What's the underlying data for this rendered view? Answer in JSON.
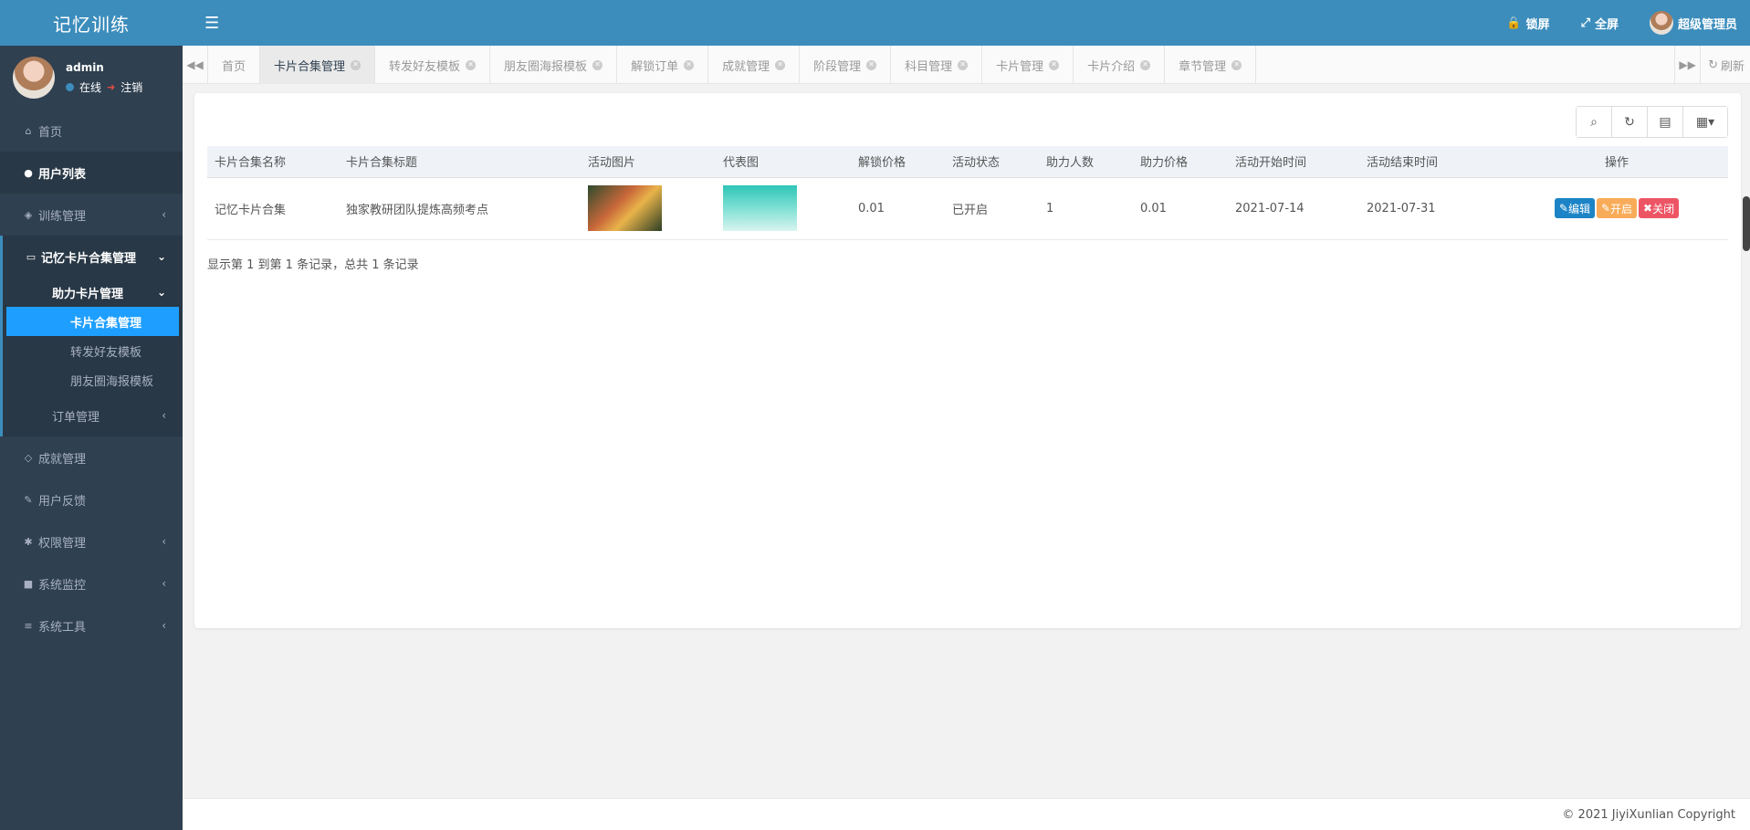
{
  "brand": "记忆训练",
  "user": {
    "name": "admin",
    "status": "在线",
    "logout": "注销"
  },
  "sidebar": {
    "items": [
      {
        "label": "首页",
        "icon": "home-icon"
      },
      {
        "label": "用户列表",
        "icon": "user-circle-icon"
      },
      {
        "label": "训练管理",
        "icon": "cube-icon"
      },
      {
        "label": "记忆卡片合集管理",
        "icon": "card-icon"
      },
      {
        "label": "成就管理",
        "icon": "diamond-icon"
      },
      {
        "label": "用户反馈",
        "icon": "edit-icon"
      },
      {
        "label": "权限管理",
        "icon": "gear-icon"
      },
      {
        "label": "系统监控",
        "icon": "video-icon"
      },
      {
        "label": "系统工具",
        "icon": "bars-icon"
      }
    ],
    "submenu": {
      "head": "助力卡片管理",
      "items": [
        "卡片合集管理",
        "转发好友模板",
        "朋友圈海报模板"
      ],
      "order": "订单管理"
    }
  },
  "topbar": {
    "lock": "锁屏",
    "fullscreen": "全屏",
    "admin": "超级管理员"
  },
  "tabs": [
    "首页",
    "卡片合集管理",
    "转发好友模板",
    "朋友圈海报模板",
    "解锁订单",
    "成就管理",
    "阶段管理",
    "科目管理",
    "卡片管理",
    "卡片介绍",
    "章节管理"
  ],
  "refresh": "刷新",
  "table": {
    "headers": [
      "卡片合集名称",
      "卡片合集标题",
      "活动图片",
      "代表图",
      "解锁价格",
      "活动状态",
      "助力人数",
      "助力价格",
      "活动开始时间",
      "活动结束时间",
      "操作"
    ],
    "rows": [
      {
        "name": "记忆卡片合集",
        "title": "独家教研团队提炼高频考点",
        "price": "0.01",
        "status": "已开启",
        "helpers": "1",
        "help_price": "0.01",
        "start": "2021-07-14",
        "end": "2021-07-31"
      }
    ],
    "actions": {
      "edit": "编辑",
      "open": "开启",
      "close": "关闭"
    },
    "summary": "显示第 1 到第 1 条记录，总共 1 条记录"
  },
  "footer": "© 2021 JiyiXunlian Copyright"
}
